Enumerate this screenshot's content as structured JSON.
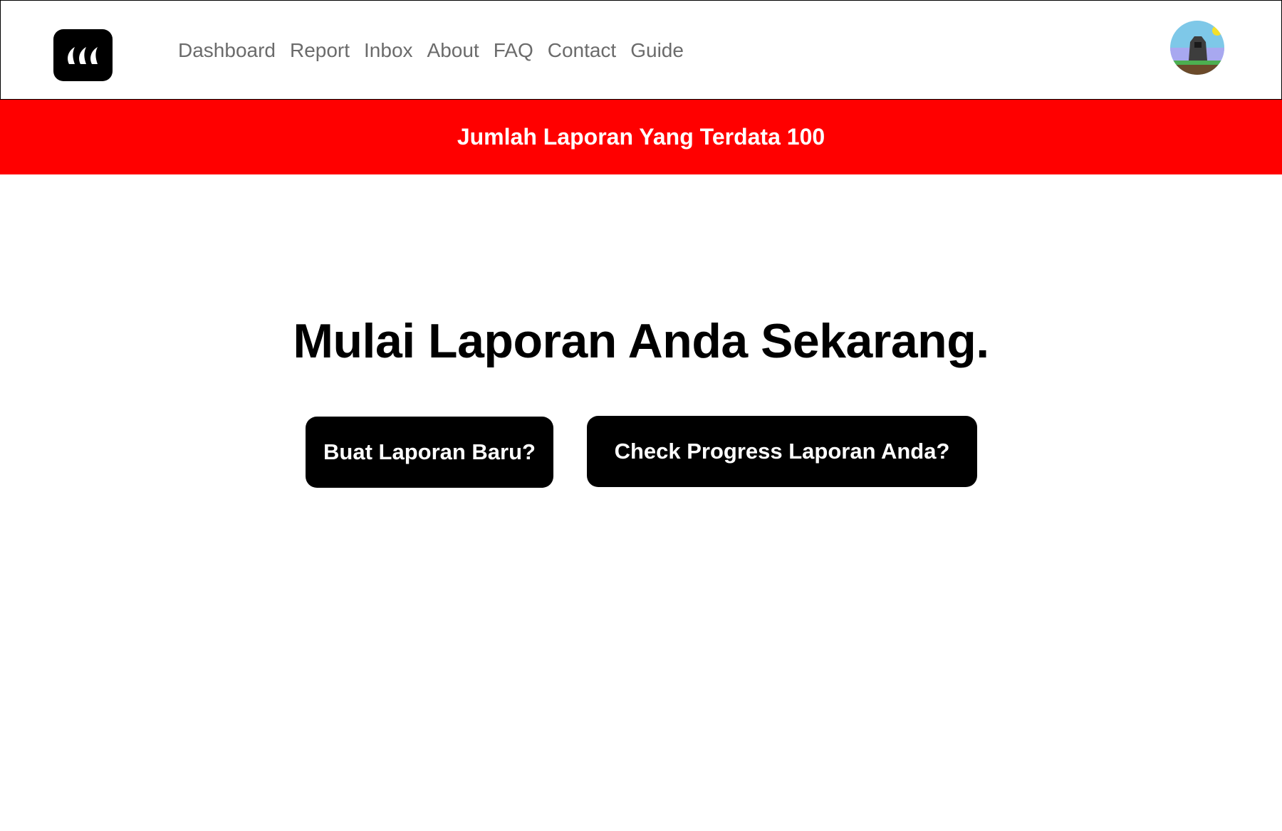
{
  "nav": {
    "logo_alt": "app-logo",
    "links": [
      {
        "label": "Dashboard"
      },
      {
        "label": "Report"
      },
      {
        "label": "Inbox"
      },
      {
        "label": "About"
      },
      {
        "label": "FAQ"
      },
      {
        "label": "Contact"
      },
      {
        "label": "Guide"
      }
    ],
    "avatar_icon": "user-avatar"
  },
  "banner": {
    "text": "Jumlah Laporan Yang Terdata 100",
    "color": "#ff0000"
  },
  "hero": {
    "headline": "Mulai Laporan Anda Sekarang.",
    "new_report_label": "Buat Laporan Baru?",
    "check_progress_label": "Check Progress Laporan Anda?"
  },
  "colors": {
    "primary": "#000000",
    "accent": "#ff0000",
    "nav_text": "#6b6b6b"
  }
}
